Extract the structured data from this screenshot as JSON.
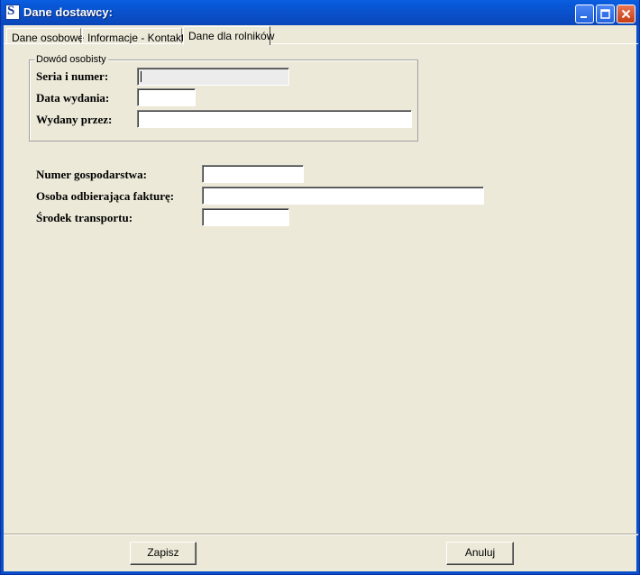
{
  "window": {
    "title": "Dane dostawcy:"
  },
  "tabs": [
    {
      "label": "Dane osobowe"
    },
    {
      "label": "Informacje - Kontakty"
    },
    {
      "label": "Dane dla rolników"
    }
  ],
  "id_group": {
    "title": "Dowód osobisty",
    "fields": [
      {
        "label": "Seria i numer:",
        "value": ""
      },
      {
        "label": "Data wydania:",
        "value": ""
      },
      {
        "label": "Wydany przez:",
        "value": ""
      }
    ]
  },
  "farm": {
    "fields": [
      {
        "label": "Numer gospodarstwa:",
        "value": ""
      },
      {
        "label": "Osoba odbierająca fakturę:",
        "value": ""
      },
      {
        "label": "Środek transportu:",
        "value": ""
      }
    ]
  },
  "buttons": {
    "save": "Zapisz",
    "cancel": "Anuluj"
  },
  "icons": {
    "app": "app-icon",
    "minimize": "minimize-icon",
    "maximize": "maximize-icon",
    "close": "close-icon"
  },
  "colors": {
    "titlebar": "#0a4fc8",
    "close_button": "#c63d14",
    "window_bg": "#ece9d8"
  }
}
